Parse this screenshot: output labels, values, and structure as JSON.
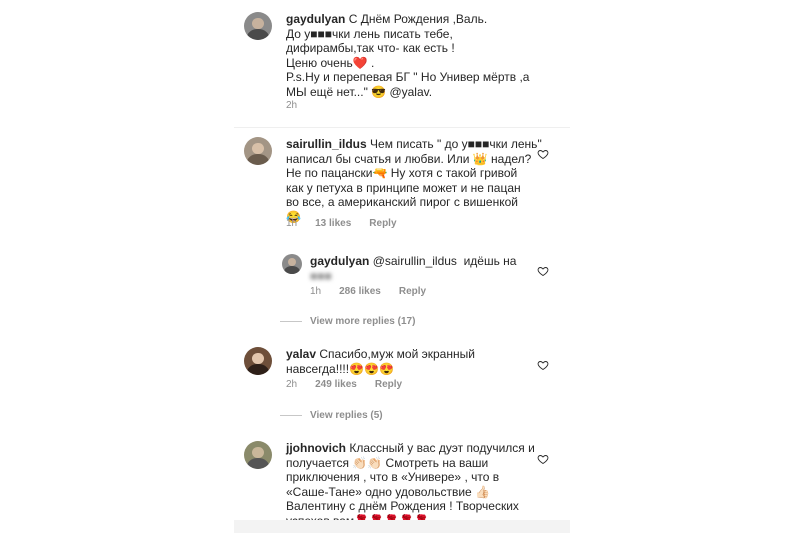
{
  "comments": [
    {
      "username": "gaydulyan",
      "text": "С Днём Рождения ,Валь.\nДо у■■■чки лень писать тебе,\nдифирамбы,так что- как есть !\nЦеню очень❤️ .\nP.s.Ну и перепевая БГ \" Но Универ мёртв ,а\nМЫ ещё нет...\" 😎 @yalav.",
      "time": "2h"
    },
    {
      "username": "sairullin_ildus",
      "text": "Чем писать \" до у■■■чки лень\"\nнаписал бы счатья и любви. Или 👑 надел?\nНе по пацански🔫 Ну хотя с такой гривой\nкак у петуха в принципе может и не пацан\nво все, а американский пирог с вишенкой\n😂",
      "time": "1h",
      "likes": "13 likes",
      "reply": "Reply"
    },
    {
      "username": "gaydulyan",
      "text": "@sairullin_ildus  идёшь на",
      "blurred": "■■■",
      "time": "1h",
      "likes": "286 likes",
      "reply": "Reply"
    },
    {
      "username": "yalav",
      "text": "Спасибо,муж мой экранный\nнавсегда!!!!😍😍😍",
      "time": "2h",
      "likes": "249 likes",
      "reply": "Reply"
    },
    {
      "username": "jjohnovich",
      "text": "Классный у вас дуэт подучился и\nполучается 👏🏻👏🏻 Смотреть на ваши\nприключения , что в «Универе» , что в\n«Саше-Тане» одно удовольствие 👍🏻\nВалентину с днём Рождения ! Творческих\nуспехов вам🌹🌹🌹🌹🌹"
    }
  ],
  "view_more_1": "View more replies (17)",
  "view_more_2": "View replies (5)",
  "icons": {
    "like": "heart-icon"
  }
}
